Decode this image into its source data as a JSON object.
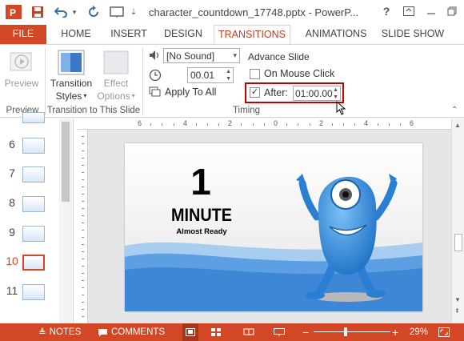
{
  "app": {
    "title": "character_countdown_17748.pptx - PowerP...",
    "help_label": "?",
    "colors": {
      "accent": "#d24726",
      "active_tab_text": "#c43e1c",
      "highlight_box": "#c00000",
      "slide_blue": "#3d87d6"
    }
  },
  "tabs": [
    "FILE",
    "HOME",
    "INSERT",
    "DESIGN",
    "TRANSITIONS",
    "ANIMATIONS",
    "SLIDE SHOW"
  ],
  "ribbon": {
    "preview": {
      "button_label": "Preview",
      "group_label": "Preview"
    },
    "transition": {
      "styles_label_line1": "Transition",
      "styles_label_line2": "Styles",
      "effect_label_line1": "Effect",
      "effect_label_line2": "Options",
      "group_label": "Transition to This Slide"
    },
    "timing": {
      "sound_value": "[No Sound]",
      "duration_value": "00.01",
      "apply_all_label": "Apply To All",
      "advance_slide_label": "Advance Slide",
      "on_mouse_click_label": "On Mouse Click",
      "on_mouse_click_checked": false,
      "after_label": "After:",
      "after_checked": true,
      "after_value": "01:00.00",
      "group_label": "Timing"
    }
  },
  "thumbnails": [
    {
      "number": "6",
      "active": false
    },
    {
      "number": "7",
      "active": false
    },
    {
      "number": "8",
      "active": false
    },
    {
      "number": "9",
      "active": false
    },
    {
      "number": "10",
      "active": true
    },
    {
      "number": "11",
      "active": false
    }
  ],
  "ruler_labels": [
    "6",
    "4",
    "2",
    "0",
    "2",
    "4",
    "6"
  ],
  "slide": {
    "big_number": "1",
    "unit_text": "MINUTE",
    "sub_text": "Almost Ready"
  },
  "statusbar": {
    "notes_label": "NOTES",
    "comments_label": "COMMENTS",
    "zoom_value": "29%",
    "zoom_slider_fraction": 0.29
  }
}
